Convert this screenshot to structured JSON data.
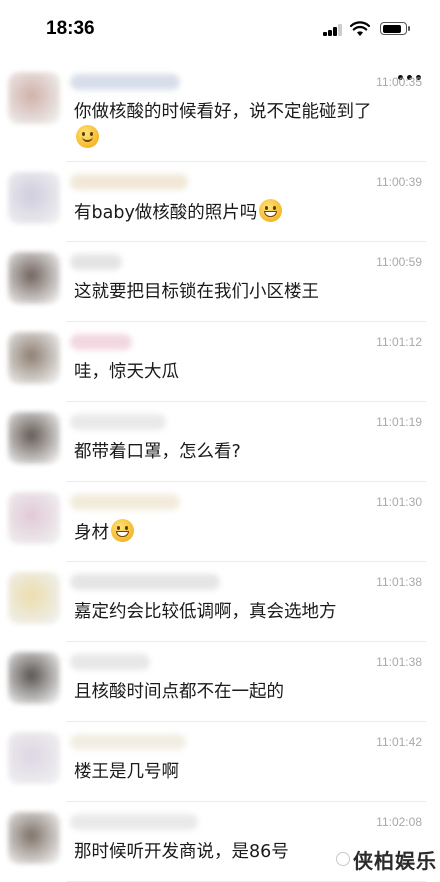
{
  "status_bar": {
    "time": "18:36"
  },
  "messages": [
    {
      "time": "11:00:35",
      "text": "你做核酸的时候看好，说不定能碰到了",
      "emoji": "smile",
      "emoji_line2": true,
      "avatar_color": "#c9a39a",
      "name_color": "#b8c4d8"
    },
    {
      "time": "11:00:39",
      "text": "有baby做核酸的照片吗",
      "emoji": "grin",
      "avatar_color": "#c8c4d8",
      "name_color": "#e6d6b8"
    },
    {
      "time": "11:00:59",
      "text": "这就要把目标锁在我们小区楼王",
      "emoji": "",
      "avatar_color": "#5a4a44",
      "name_color": "#cfcfcf"
    },
    {
      "time": "11:01:12",
      "text": "哇，惊天大瓜",
      "emoji": "",
      "avatar_color": "#7a6a5a",
      "name_color": "#e8b8c8"
    },
    {
      "time": "11:01:19",
      "text": "都带着口罩，怎么看?",
      "emoji": "",
      "avatar_color": "#4a3f38",
      "name_color": "#d8d8d8"
    },
    {
      "time": "11:01:30",
      "text": "身材",
      "emoji": "grin",
      "avatar_color": "#dcc0d0",
      "name_color": "#e8dcc0"
    },
    {
      "time": "11:01:38",
      "text": "嘉定约会比较低调啊，真会选地方",
      "emoji": "",
      "avatar_color": "#e8d8a0",
      "name_color": "#d0d0d0"
    },
    {
      "time": "11:01:38",
      "text": "且核酸时间点都不在一起的",
      "emoji": "",
      "avatar_color": "#3e3834",
      "name_color": "#d4d4d4"
    },
    {
      "time": "11:01:42",
      "text": "楼王是几号啊",
      "emoji": "",
      "avatar_color": "#d8cfe0",
      "name_color": "#e8e0cc"
    },
    {
      "time": "11:02:08",
      "text": "那时候听开发商说，是86号",
      "emoji": "",
      "avatar_color": "#6a5a50",
      "name_color": "#d8d8d8"
    }
  ],
  "watermark": {
    "text": "侠柏娱乐"
  }
}
